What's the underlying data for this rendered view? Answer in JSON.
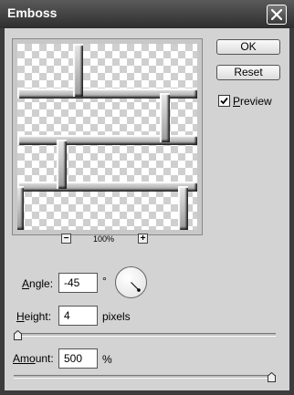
{
  "title": "Emboss",
  "buttons": {
    "ok": "OK",
    "reset": "Reset"
  },
  "preview_checkbox": {
    "label_first": "P",
    "label_rest": "review",
    "checked": true
  },
  "zoom": {
    "minus": "−",
    "plus": "+",
    "level": "100%"
  },
  "angle": {
    "label_first": "A",
    "label_rest": "ngle:",
    "value": "-45",
    "unit": "°",
    "degrees": -45
  },
  "height": {
    "label_first": "H",
    "label_rest": "eight:",
    "value": "4",
    "unit": "pixels",
    "slider_fraction": 0.0
  },
  "amount": {
    "label_first": "Am",
    "label_rest_underlined": "o",
    "label_tail": "unt:",
    "value": "500",
    "unit": "%",
    "slider_fraction": 1.0
  },
  "icons": {
    "close": "close-icon",
    "check": "checkmark-icon"
  }
}
